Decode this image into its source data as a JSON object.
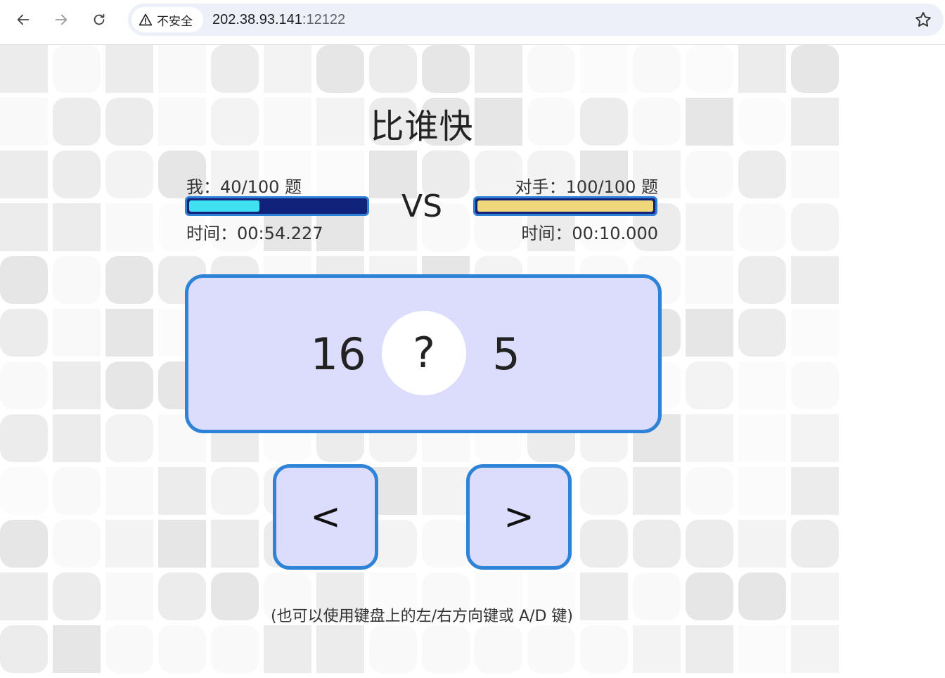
{
  "browser": {
    "security_label": "不安全",
    "url_host": "202.38.93.141",
    "url_port": ":12122"
  },
  "game": {
    "title": "比谁快",
    "me": {
      "label": "我：40/100 题",
      "progress": 0.4,
      "time": "时间：00:54.227",
      "bar_color": "#11227a",
      "fill_color": "#3fe0f0"
    },
    "vs": "VS",
    "opponent": {
      "label": "对手：100/100 题",
      "progress": 1.0,
      "time": "时间：00:10.000",
      "fill_color": "#f0d87a"
    },
    "question": {
      "left": "16",
      "operator": "?",
      "right": "5"
    },
    "buttons": {
      "less": "<",
      "greater": ">"
    },
    "hint": "(也可以使用键盘上的左/右方向键或 A/D 键)"
  },
  "colors": {
    "accent": "#2f83d6",
    "card_bg": "#dcdcfc"
  }
}
